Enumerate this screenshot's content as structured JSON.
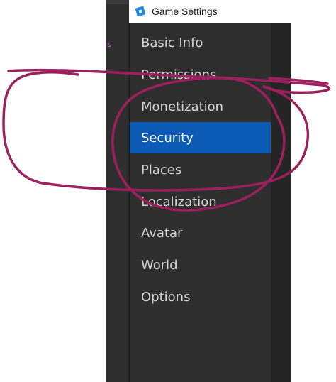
{
  "editor": {
    "accent_text": "s"
  },
  "window": {
    "title": "Game Settings",
    "icon": "roblox-studio-icon"
  },
  "sidebar": {
    "items": [
      {
        "label": "Basic Info"
      },
      {
        "label": "Permissions"
      },
      {
        "label": "Monetization"
      },
      {
        "label": "Security",
        "selected": true
      },
      {
        "label": "Places"
      },
      {
        "label": "Localization"
      },
      {
        "label": "Avatar"
      },
      {
        "label": "World"
      },
      {
        "label": "Options"
      }
    ]
  },
  "colors": {
    "sidebar_bg": "#2e2e2e",
    "selected_bg": "#0b5bb5",
    "item_text": "#d6d6d6",
    "annotation_stroke": "#9c1f5e"
  }
}
